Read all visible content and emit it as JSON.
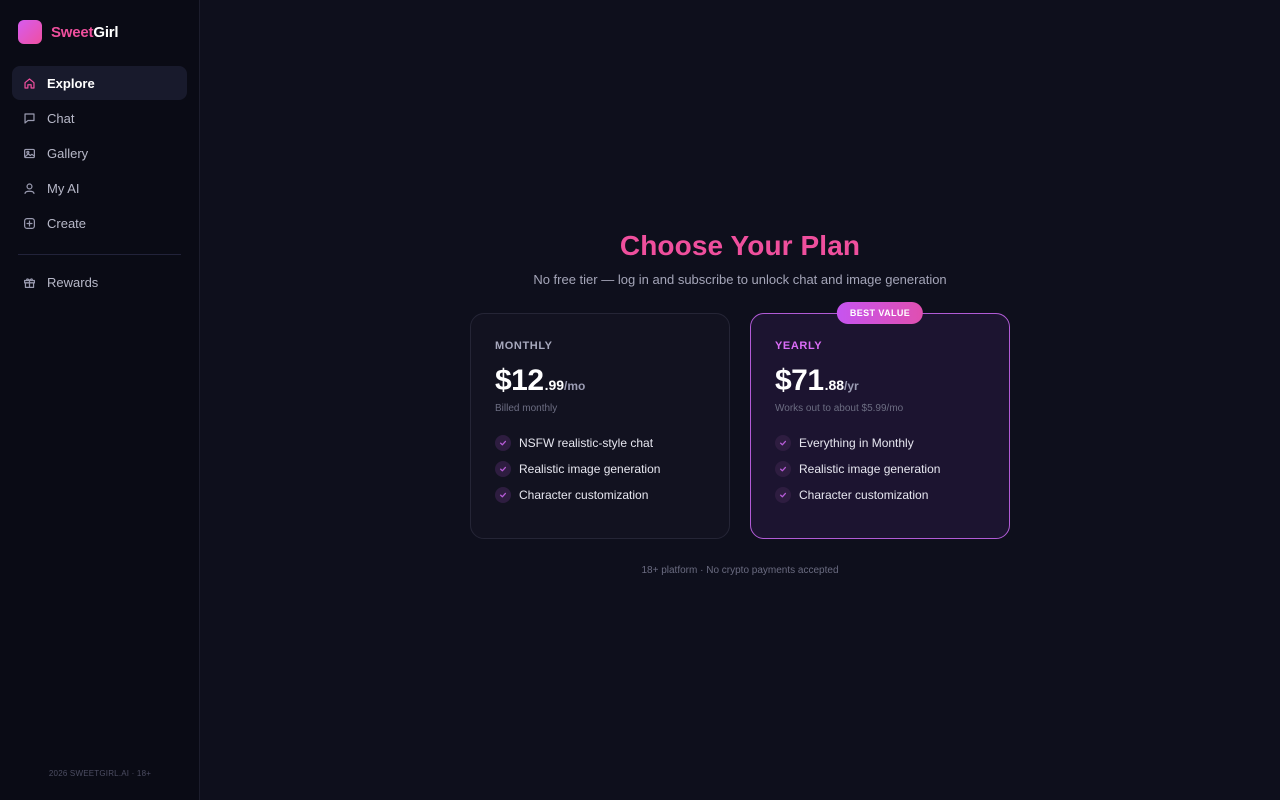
{
  "brand": {
    "name_part1": "Sweet",
    "name_part2": "Girl"
  },
  "sidebar": {
    "items": [
      {
        "label": "Explore",
        "icon": "home-icon",
        "active": true
      },
      {
        "label": "Chat",
        "icon": "chat-bubble-icon",
        "active": false
      },
      {
        "label": "Gallery",
        "icon": "image-icon",
        "active": false
      },
      {
        "label": "My AI",
        "icon": "user-icon",
        "active": false
      },
      {
        "label": "Create",
        "icon": "plus-square-icon",
        "active": false
      }
    ],
    "secondary_items": [
      {
        "label": "Rewards",
        "icon": "gift-icon",
        "active": false
      }
    ],
    "footer": "2026 SWEETGIRL.AI · 18+"
  },
  "main": {
    "title": "Choose Your Plan",
    "subtitle": "No free tier — log in and subscribe to unlock chat and image generation",
    "plans": [
      {
        "name": "MONTHLY",
        "price_whole": "$12",
        "price_cents": ".99",
        "price_period": "/mo",
        "note": "Billed monthly",
        "features": [
          "NSFW realistic-style chat",
          "Realistic image generation",
          "Character customization"
        ]
      },
      {
        "name": "YEARLY",
        "badge": "BEST VALUE",
        "price_whole": "$71",
        "price_cents": ".88",
        "price_period": "/yr",
        "note": "Works out to about $5.99/mo",
        "features": [
          "Everything in Monthly",
          "Realistic image generation",
          "Character customization"
        ]
      }
    ],
    "footnote": "18+ platform · No crypto payments accepted"
  },
  "colors": {
    "accent_pink": "#ef4f9d",
    "accent_purple": "#b15bd6",
    "background": "#0e0f1c",
    "sidebar_background": "#0a0b15"
  }
}
